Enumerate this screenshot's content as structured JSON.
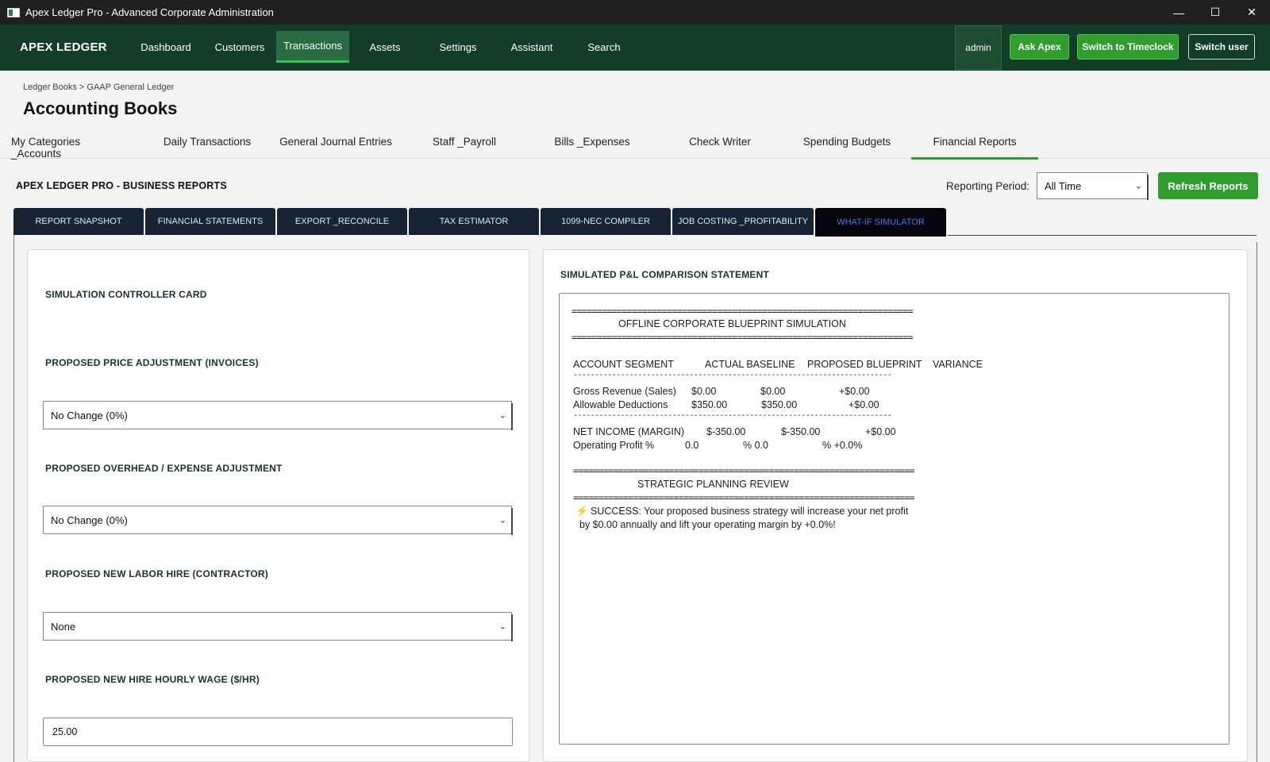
{
  "window": {
    "title": "Apex Ledger Pro - Advanced Corporate Administration",
    "min": "—",
    "max": "☐",
    "close": "✕"
  },
  "nav": {
    "brand": "APEX LEDGER",
    "items": [
      "Dashboard",
      "Customers",
      "Transactions",
      "Assets",
      "Settings",
      "Assistant",
      "Search"
    ],
    "active": "Transactions",
    "user": "admin",
    "ask": "Ask Apex",
    "timeclock": "Switch to Timeclock",
    "switch_user": "Switch user"
  },
  "header": {
    "breadcrumb": "Ledger Books > GAAP General Ledger",
    "title": "Accounting Books"
  },
  "section_tabs": [
    "My Categories _Accounts",
    "Daily Transactions",
    "General Journal Entries",
    "Staff _Payroll",
    "Bills _Expenses",
    "Check Writer",
    "Spending Budgets",
    "Financial Reports"
  ],
  "section_tabs_active": "Financial Reports",
  "reports": {
    "title": "APEX LEDGER PRO - BUSINESS REPORTS",
    "period_label": "Reporting Period:",
    "period_value": "All Time",
    "refresh": "Refresh Reports",
    "tabs": [
      "REPORT SNAPSHOT",
      "FINANCIAL STATEMENTS",
      "EXPORT _RECONCILE",
      "TAX ESTIMATOR",
      "1099-NEC COMPILER",
      "JOB COSTING _PROFITABILITY",
      "WHAT-IF SIMULATOR"
    ],
    "active_tab": "WHAT-IF SIMULATOR"
  },
  "controller": {
    "title": "SIMULATION CONTROLLER CARD",
    "price_label": "PROPOSED PRICE ADJUSTMENT (INVOICES)",
    "price_value": "No Change (0%)",
    "overhead_label": "PROPOSED OVERHEAD / EXPENSE ADJUSTMENT",
    "overhead_value": "No Change (0%)",
    "labor_label": "PROPOSED NEW LABOR HIRE (CONTRACTOR)",
    "labor_value": "None",
    "wage_label": "PROPOSED NEW HIRE HOURLY WAGE ($/HR)",
    "wage_value": "25.00"
  },
  "statement": {
    "title": "SIMULATED P&L COMPARISON STATEMENT",
    "rule_eq": "====================================================================",
    "rule_dash": "--------------------------------------------------------------------------",
    "heading1": "OFFLINE CORPORATE BLUEPRINT SIMULATION",
    "columns": [
      "ACCOUNT SEGMENT",
      "ACTUAL BASELINE",
      "PROPOSED BLUEPRINT",
      "VARIANCE"
    ],
    "rows": [
      [
        "Gross Revenue (Sales)",
        "$0.00",
        "$0.00",
        "+$0.00"
      ],
      [
        "Allowable Deductions",
        "$350.00",
        "$350.00",
        "+$0.00"
      ],
      [
        "NET INCOME (MARGIN)",
        "$-350.00",
        "$-350.00",
        "+$0.00"
      ],
      [
        "Operating Profit %",
        "0.0",
        "% 0.0",
        "% +0.0%"
      ]
    ],
    "heading2": "STRATEGIC PLANNING REVIEW",
    "msg1": "SUCCESS: Your proposed business strategy will increase your net profit",
    "msg2": "by $0.00 annually and lift your operating margin by +0.0%!"
  }
}
